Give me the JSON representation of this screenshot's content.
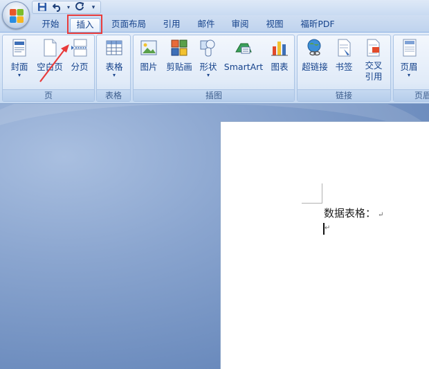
{
  "quick_access": {
    "save_icon": "save-icon",
    "undo_icon": "undo-icon",
    "redo_icon": "redo-icon",
    "customize_icon": "customize-qat-icon"
  },
  "tabs": [
    {
      "label": "开始"
    },
    {
      "label": "插入",
      "active": true
    },
    {
      "label": "页面布局"
    },
    {
      "label": "引用"
    },
    {
      "label": "邮件"
    },
    {
      "label": "审阅"
    },
    {
      "label": "视图"
    },
    {
      "label": "福昕PDF"
    }
  ],
  "ribbon": {
    "groups": [
      {
        "label": "页",
        "buttons": [
          {
            "label": "封面",
            "icon": "cover-page-icon"
          },
          {
            "label": "空白页",
            "icon": "blank-page-icon"
          },
          {
            "label": "分页",
            "icon": "page-break-icon"
          }
        ]
      },
      {
        "label": "表格",
        "buttons": [
          {
            "label": "表格",
            "icon": "table-icon"
          }
        ]
      },
      {
        "label": "插图",
        "buttons": [
          {
            "label": "图片",
            "icon": "picture-icon"
          },
          {
            "label": "剪贴画",
            "icon": "clip-art-icon"
          },
          {
            "label": "形状",
            "icon": "shapes-icon"
          },
          {
            "label": "SmartArt",
            "icon": "smartart-icon"
          },
          {
            "label": "图表",
            "icon": "chart-icon"
          }
        ]
      },
      {
        "label": "链接",
        "buttons": [
          {
            "label": "超链接",
            "icon": "hyperlink-icon"
          },
          {
            "label": "书签",
            "icon": "bookmark-icon"
          },
          {
            "label": "交叉",
            "label2": "引用",
            "icon": "cross-reference-icon"
          }
        ]
      },
      {
        "label": "页眉",
        "buttons": [
          {
            "label": "页眉",
            "icon": "header-icon"
          }
        ]
      }
    ]
  },
  "document": {
    "line1": "数据表格：",
    "paragraph_mark": "↵"
  },
  "colors": {
    "highlight": "#e83a3a"
  }
}
